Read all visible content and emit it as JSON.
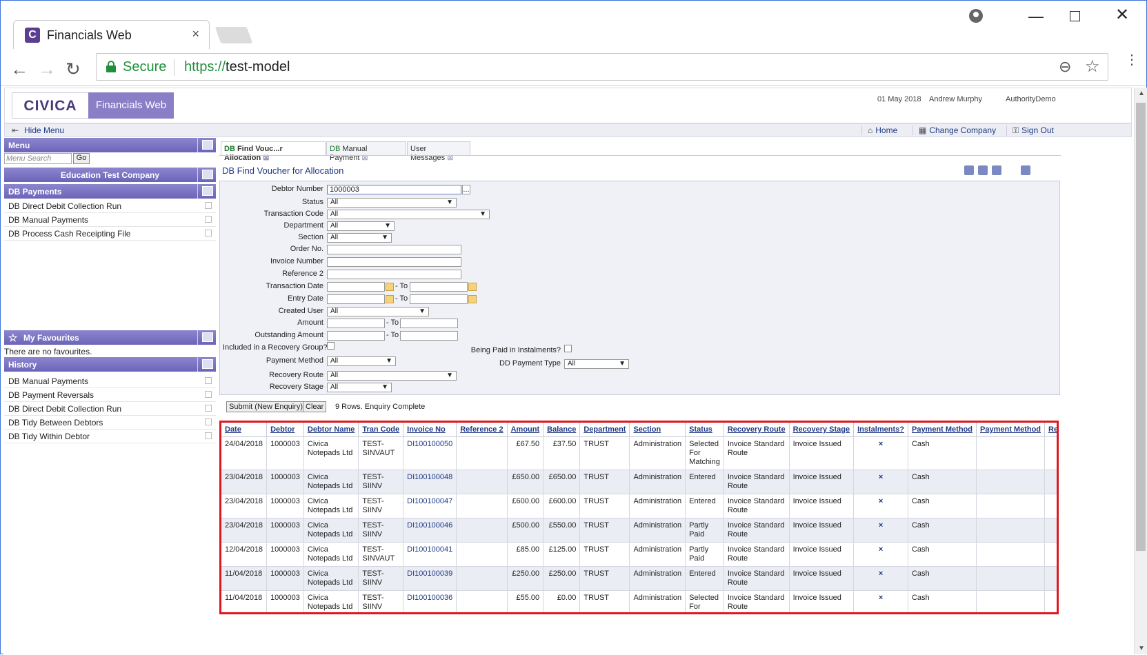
{
  "browser": {
    "tab_title": "Financials Web",
    "tab_close": "×",
    "secure_label": "Secure",
    "url_scheme": "https://",
    "url_host": "test-model",
    "accent": "#1e8f3a"
  },
  "header": {
    "logo_text": "CIVICA",
    "product": "Financials Web",
    "date": "01 May 2018",
    "user": "Andrew Murphy",
    "authority": "AuthorityDemo",
    "brand_color": "#8a7fc7"
  },
  "toolbar": {
    "hide_menu": "Hide Menu",
    "home": "Home",
    "change_company": "Change Company",
    "sign_out": "Sign Out"
  },
  "sidebar": {
    "menu_title": "Menu",
    "search_placeholder": "Menu Search",
    "go": "Go",
    "company": "Education Test Company",
    "section": "DB Payments",
    "items": [
      {
        "label": "DB Direct Debit Collection Run"
      },
      {
        "label": "DB Manual Payments"
      },
      {
        "label": "DB Process Cash Receipting File"
      }
    ],
    "favourites_title": "My Favourites",
    "favourites_empty": "There are no favourites.",
    "history_title": "History",
    "history": [
      {
        "label": "DB Manual Payments"
      },
      {
        "label": "DB Payment Reversals"
      },
      {
        "label": "DB Direct Debit Collection Run"
      },
      {
        "label": "DB Tidy Between Debtors"
      },
      {
        "label": "DB Tidy Within Debtor"
      }
    ]
  },
  "tabs": [
    {
      "prefix": "DB",
      "label": "Find Vouc...r Allocation"
    },
    {
      "prefix": "DB",
      "label": "Manual Payment"
    },
    {
      "prefix": "",
      "label": "User Messages"
    }
  ],
  "form": {
    "title": "DB Find Voucher for Allocation",
    "debtor_number_label": "Debtor Number",
    "debtor_number": "1000003",
    "lookup": "...",
    "status_label": "Status",
    "status": "All",
    "transaction_code_label": "Transaction Code",
    "transaction_code": "All",
    "department_label": "Department",
    "department": "All",
    "section_label": "Section",
    "section": "All",
    "order_no_label": "Order No.",
    "invoice_number_label": "Invoice Number",
    "reference2_label": "Reference 2",
    "transaction_date_label": "Transaction Date",
    "entry_date_label": "Entry Date",
    "to_label": "- To",
    "created_user_label": "Created User",
    "created_user": "All",
    "amount_label": "Amount",
    "outstanding_amount_label": "Outstanding Amount",
    "recovery_group_label": "Included in a Recovery Group?",
    "instalments_label": "Being Paid in Instalments?",
    "payment_method_label": "Payment Method",
    "payment_method": "All",
    "dd_payment_type_label": "DD Payment Type",
    "dd_payment_type": "All",
    "recovery_route_label": "Recovery Route",
    "recovery_route": "All",
    "recovery_stage_label": "Recovery Stage",
    "recovery_stage": "All",
    "submit": "Submit (New Enquiry)",
    "clear": "Clear",
    "status_text": "9 Rows. Enquiry Complete"
  },
  "results": {
    "columns": [
      "Date",
      "Debtor",
      "Debtor Name",
      "Tran Code",
      "Invoice No",
      "Reference 2",
      "Amount",
      "Balance",
      "Department",
      "Section",
      "Status",
      "Recovery Route",
      "Recovery Stage",
      "Instalments?",
      "Payment Method",
      "Payment Method",
      "Recove"
    ],
    "rows": [
      [
        "24/04/2018",
        "1000003",
        "Civica Notepads Ltd",
        "TEST-SINVAUT",
        "DI100100050",
        "",
        "£67.50",
        "£37.50",
        "TRUST",
        "Administration",
        "Selected For Matching",
        "Invoice Standard Route",
        "Invoice Issued",
        "×",
        "Cash",
        "",
        ""
      ],
      [
        "23/04/2018",
        "1000003",
        "Civica Notepads Ltd",
        "TEST-SIINV",
        "DI100100048",
        "",
        "£650.00",
        "£650.00",
        "TRUST",
        "Administration",
        "Entered",
        "Invoice Standard Route",
        "Invoice Issued",
        "×",
        "Cash",
        "",
        ""
      ],
      [
        "23/04/2018",
        "1000003",
        "Civica Notepads Ltd",
        "TEST-SIINV",
        "DI100100047",
        "",
        "£600.00",
        "£600.00",
        "TRUST",
        "Administration",
        "Entered",
        "Invoice Standard Route",
        "Invoice Issued",
        "×",
        "Cash",
        "",
        ""
      ],
      [
        "23/04/2018",
        "1000003",
        "Civica Notepads Ltd",
        "TEST-SIINV",
        "DI100100046",
        "",
        "£500.00",
        "£550.00",
        "TRUST",
        "Administration",
        "Partly Paid",
        "Invoice Standard Route",
        "Invoice Issued",
        "×",
        "Cash",
        "",
        ""
      ],
      [
        "12/04/2018",
        "1000003",
        "Civica Notepads Ltd",
        "TEST-SINVAUT",
        "DI100100041",
        "",
        "£85.00",
        "£125.00",
        "TRUST",
        "Administration",
        "Partly Paid",
        "Invoice Standard Route",
        "Invoice Issued",
        "×",
        "Cash",
        "",
        ""
      ],
      [
        "11/04/2018",
        "1000003",
        "Civica Notepads Ltd",
        "TEST-SIINV",
        "DI100100039",
        "",
        "£250.00",
        "£250.00",
        "TRUST",
        "Administration",
        "Entered",
        "Invoice Standard Route",
        "Invoice Issued",
        "×",
        "Cash",
        "",
        ""
      ],
      [
        "11/04/2018",
        "1000003",
        "Civica Notepads Ltd",
        "TEST-SIINV",
        "DI100100036",
        "",
        "£55.00",
        "£0.00",
        "TRUST",
        "Administration",
        "Selected For Matching",
        "Invoice Standard Route",
        "Invoice Issued",
        "×",
        "Cash",
        "",
        ""
      ]
    ],
    "highlight_color": "#e2141c"
  }
}
